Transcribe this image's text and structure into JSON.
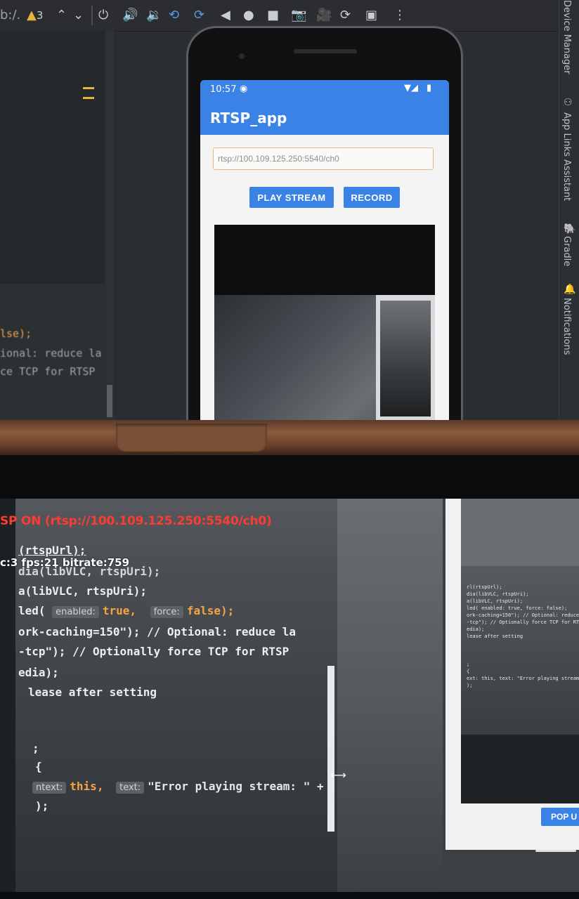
{
  "monitor": {
    "toolbar": {
      "left_fragment": "b:/.",
      "warning_count": "3",
      "kebab": "⋮"
    },
    "editor_lines": [
      {
        "text": "lse);",
        "color": "#f0a048"
      },
      {
        "text": "ional: reduce la",
        "color": "#9aa7b4"
      },
      {
        "text": "ce TCP for RTSP",
        "color": "#9aa7b4"
      }
    ],
    "side_panel": {
      "labels": [
        "Device Manager",
        "App Links Assistant",
        "Gradle",
        "Notifications"
      ]
    },
    "phone": {
      "status_time": "10:57",
      "app_title": "RTSP_app",
      "url_value": "rtsp://100.109.125.250:5540/ch0",
      "play_label": "PLAY STREAM",
      "record_label": "RECORD"
    }
  },
  "handset": {
    "overlay_status": "SP ON (rtsp://100.109.125.250:5540/ch0)",
    "overlay_stats": "c:3 fps:21 bitrate:759",
    "code": {
      "l1": "(rtspUrl);",
      "l2": "dia(libVLC, rtspUri);",
      "l3": "a(libVLC, rtspUri);",
      "l4_prefix": "led(",
      "hint_enabled": "enabled:",
      "val_true": "true,",
      "hint_force": "force:",
      "val_false": "false);",
      "l5": "ork-caching=150\"); // Optional: reduce la",
      "l6": "-tcp\"); // Optionally force TCP for RTSP",
      "l7": "edia);",
      "l8": "lease after setting",
      "l9": ";",
      "l10": "{",
      "hint_context": "ntext:",
      "val_this": "this,",
      "hint_text": "text:",
      "val_error": "\"Error playing stream: \" +",
      "l12": ");"
    },
    "mirror_code": [
      "rl(rtspUrl);",
      "dia(libVLC, rtspUri);",
      "a(libVLC, rtspUri);",
      "led( enabled: true,  force: false);",
      "ork-caching=150\"); // Optional: reduce",
      "-tcp\"); // Optionally force TCP for RTS",
      "edia);",
      "lease after setting",
      "",
      "",
      "",
      ";",
      "{",
      "ext: this,  text: \"Error playing stream:",
      ");"
    ],
    "pop_label": "POP U"
  }
}
